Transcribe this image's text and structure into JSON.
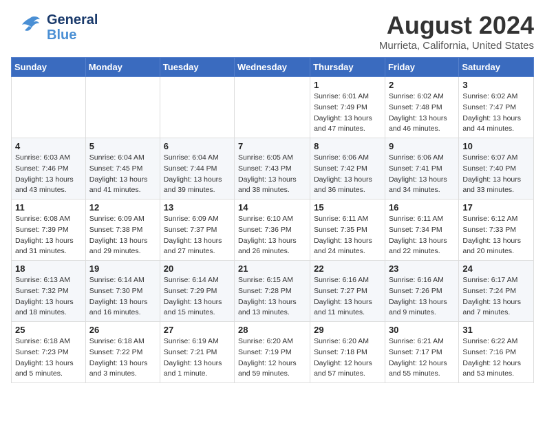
{
  "header": {
    "logo_general": "General",
    "logo_blue": "Blue",
    "month_title": "August 2024",
    "location": "Murrieta, California, United States"
  },
  "days_of_week": [
    "Sunday",
    "Monday",
    "Tuesday",
    "Wednesday",
    "Thursday",
    "Friday",
    "Saturday"
  ],
  "weeks": [
    [
      {
        "day": "",
        "info": ""
      },
      {
        "day": "",
        "info": ""
      },
      {
        "day": "",
        "info": ""
      },
      {
        "day": "",
        "info": ""
      },
      {
        "day": "1",
        "info": "Sunrise: 6:01 AM\nSunset: 7:49 PM\nDaylight: 13 hours\nand 47 minutes."
      },
      {
        "day": "2",
        "info": "Sunrise: 6:02 AM\nSunset: 7:48 PM\nDaylight: 13 hours\nand 46 minutes."
      },
      {
        "day": "3",
        "info": "Sunrise: 6:02 AM\nSunset: 7:47 PM\nDaylight: 13 hours\nand 44 minutes."
      }
    ],
    [
      {
        "day": "4",
        "info": "Sunrise: 6:03 AM\nSunset: 7:46 PM\nDaylight: 13 hours\nand 43 minutes."
      },
      {
        "day": "5",
        "info": "Sunrise: 6:04 AM\nSunset: 7:45 PM\nDaylight: 13 hours\nand 41 minutes."
      },
      {
        "day": "6",
        "info": "Sunrise: 6:04 AM\nSunset: 7:44 PM\nDaylight: 13 hours\nand 39 minutes."
      },
      {
        "day": "7",
        "info": "Sunrise: 6:05 AM\nSunset: 7:43 PM\nDaylight: 13 hours\nand 38 minutes."
      },
      {
        "day": "8",
        "info": "Sunrise: 6:06 AM\nSunset: 7:42 PM\nDaylight: 13 hours\nand 36 minutes."
      },
      {
        "day": "9",
        "info": "Sunrise: 6:06 AM\nSunset: 7:41 PM\nDaylight: 13 hours\nand 34 minutes."
      },
      {
        "day": "10",
        "info": "Sunrise: 6:07 AM\nSunset: 7:40 PM\nDaylight: 13 hours\nand 33 minutes."
      }
    ],
    [
      {
        "day": "11",
        "info": "Sunrise: 6:08 AM\nSunset: 7:39 PM\nDaylight: 13 hours\nand 31 minutes."
      },
      {
        "day": "12",
        "info": "Sunrise: 6:09 AM\nSunset: 7:38 PM\nDaylight: 13 hours\nand 29 minutes."
      },
      {
        "day": "13",
        "info": "Sunrise: 6:09 AM\nSunset: 7:37 PM\nDaylight: 13 hours\nand 27 minutes."
      },
      {
        "day": "14",
        "info": "Sunrise: 6:10 AM\nSunset: 7:36 PM\nDaylight: 13 hours\nand 26 minutes."
      },
      {
        "day": "15",
        "info": "Sunrise: 6:11 AM\nSunset: 7:35 PM\nDaylight: 13 hours\nand 24 minutes."
      },
      {
        "day": "16",
        "info": "Sunrise: 6:11 AM\nSunset: 7:34 PM\nDaylight: 13 hours\nand 22 minutes."
      },
      {
        "day": "17",
        "info": "Sunrise: 6:12 AM\nSunset: 7:33 PM\nDaylight: 13 hours\nand 20 minutes."
      }
    ],
    [
      {
        "day": "18",
        "info": "Sunrise: 6:13 AM\nSunset: 7:32 PM\nDaylight: 13 hours\nand 18 minutes."
      },
      {
        "day": "19",
        "info": "Sunrise: 6:14 AM\nSunset: 7:30 PM\nDaylight: 13 hours\nand 16 minutes."
      },
      {
        "day": "20",
        "info": "Sunrise: 6:14 AM\nSunset: 7:29 PM\nDaylight: 13 hours\nand 15 minutes."
      },
      {
        "day": "21",
        "info": "Sunrise: 6:15 AM\nSunset: 7:28 PM\nDaylight: 13 hours\nand 13 minutes."
      },
      {
        "day": "22",
        "info": "Sunrise: 6:16 AM\nSunset: 7:27 PM\nDaylight: 13 hours\nand 11 minutes."
      },
      {
        "day": "23",
        "info": "Sunrise: 6:16 AM\nSunset: 7:26 PM\nDaylight: 13 hours\nand 9 minutes."
      },
      {
        "day": "24",
        "info": "Sunrise: 6:17 AM\nSunset: 7:24 PM\nDaylight: 13 hours\nand 7 minutes."
      }
    ],
    [
      {
        "day": "25",
        "info": "Sunrise: 6:18 AM\nSunset: 7:23 PM\nDaylight: 13 hours\nand 5 minutes."
      },
      {
        "day": "26",
        "info": "Sunrise: 6:18 AM\nSunset: 7:22 PM\nDaylight: 13 hours\nand 3 minutes."
      },
      {
        "day": "27",
        "info": "Sunrise: 6:19 AM\nSunset: 7:21 PM\nDaylight: 13 hours\nand 1 minute."
      },
      {
        "day": "28",
        "info": "Sunrise: 6:20 AM\nSunset: 7:19 PM\nDaylight: 12 hours\nand 59 minutes."
      },
      {
        "day": "29",
        "info": "Sunrise: 6:20 AM\nSunset: 7:18 PM\nDaylight: 12 hours\nand 57 minutes."
      },
      {
        "day": "30",
        "info": "Sunrise: 6:21 AM\nSunset: 7:17 PM\nDaylight: 12 hours\nand 55 minutes."
      },
      {
        "day": "31",
        "info": "Sunrise: 6:22 AM\nSunset: 7:16 PM\nDaylight: 12 hours\nand 53 minutes."
      }
    ]
  ]
}
